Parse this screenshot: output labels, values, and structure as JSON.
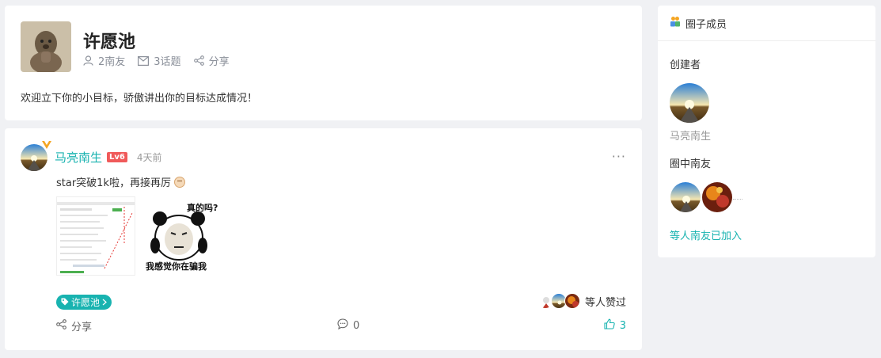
{
  "circle": {
    "title": "许愿池",
    "members_count": "2南友",
    "topics_count": "3话题",
    "share_label": "分享",
    "description": "欢迎立下你的小目标，骄傲讲出你的目标达成情况！"
  },
  "post": {
    "author": "马亮南生",
    "level": "Lv6",
    "time": "4天前",
    "more": "···",
    "content": "star突破1k啦，再接再厉",
    "meme_top_text": "真的吗?",
    "meme_bottom_text": "我感觉你在骗我",
    "tag": "许愿池",
    "likers_text": "等人赞过",
    "share_label": "分享",
    "comment_count": "0",
    "like_count": "3"
  },
  "members": {
    "header": "圈子成员",
    "creator_label": "创建者",
    "creator_name": "马亮南生",
    "members_label": "圈中南友",
    "join_text": "等人南友已加入"
  },
  "colors": {
    "accent": "#18b3b0",
    "level_badge": "#f05a5a",
    "background": "#f0f1f4"
  }
}
